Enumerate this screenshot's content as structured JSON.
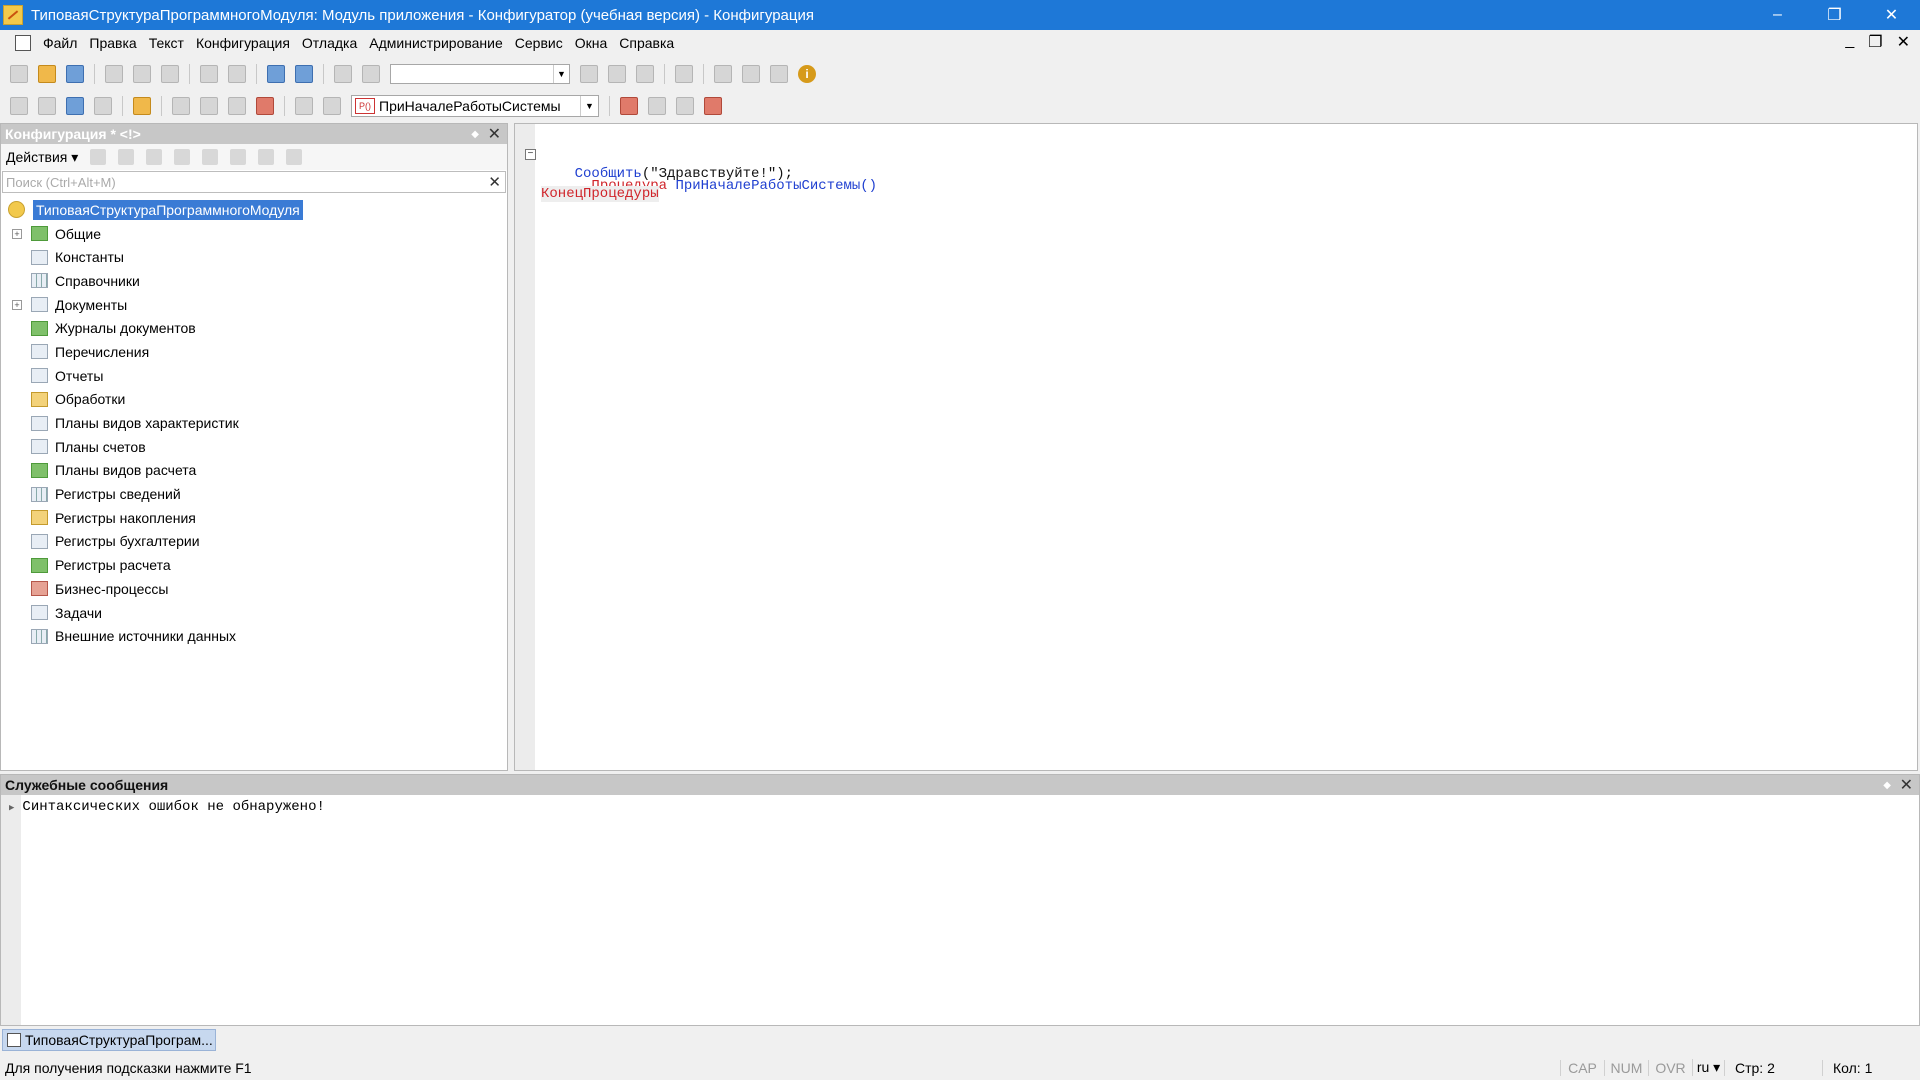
{
  "window": {
    "title": "ТиповаяСтруктураПрограммногоМодуля: Модуль приложения - Конфигуратор (учебная версия) - Конфигурация",
    "minimize": "–",
    "restore": "❐",
    "close": "✕"
  },
  "menu": {
    "items": [
      "Файл",
      "Правка",
      "Текст",
      "Конфигурация",
      "Отладка",
      "Администрирование",
      "Сервис",
      "Окна",
      "Справка"
    ],
    "mdi_minimize": "_",
    "mdi_restore": "❐",
    "mdi_close": "✕"
  },
  "toolbar": {
    "procedure_selector": "ПриНачалеРаботыСистемы",
    "info": "i"
  },
  "config_panel": {
    "title": "Конфигурация * <!>",
    "actions_label": "Действия ▾",
    "search_placeholder": "Поиск (Ctrl+Alt+M)",
    "tree": [
      {
        "label": "ТиповаяСтруктураПрограммногоМодуля",
        "icon": "config-root-icon"
      },
      {
        "label": "Общие",
        "icon": "common-icon",
        "expandable": true
      },
      {
        "label": "Константы",
        "icon": "constants-icon"
      },
      {
        "label": "Справочники",
        "icon": "catalogs-icon"
      },
      {
        "label": "Документы",
        "icon": "documents-icon",
        "expandable": true
      },
      {
        "label": "Журналы документов",
        "icon": "document-journals-icon"
      },
      {
        "label": "Перечисления",
        "icon": "enums-icon"
      },
      {
        "label": "Отчеты",
        "icon": "reports-icon"
      },
      {
        "label": "Обработки",
        "icon": "data-processors-icon"
      },
      {
        "label": "Планы видов характеристик",
        "icon": "chart-of-characteristic-types-icon"
      },
      {
        "label": "Планы счетов",
        "icon": "chart-of-accounts-icon"
      },
      {
        "label": "Планы видов расчета",
        "icon": "chart-of-calculation-types-icon"
      },
      {
        "label": "Регистры сведений",
        "icon": "information-registers-icon"
      },
      {
        "label": "Регистры накопления",
        "icon": "accumulation-registers-icon"
      },
      {
        "label": "Регистры бухгалтерии",
        "icon": "accounting-registers-icon"
      },
      {
        "label": "Регистры расчета",
        "icon": "calculation-registers-icon"
      },
      {
        "label": "Бизнес-процессы",
        "icon": "business-processes-icon"
      },
      {
        "label": "Задачи",
        "icon": "tasks-icon"
      },
      {
        "label": "Внешние источники данных",
        "icon": "external-data-sources-icon"
      }
    ]
  },
  "editor": {
    "line1_keyword": "Процедура",
    "line1_name": "ПриНачалеРаботыСистемы()",
    "line2_indent": "    ",
    "line2_call": "Сообщить",
    "line2_args": "(\"Здравствуйте!\");",
    "line3_keyword": "КонецПроцедуры"
  },
  "messages": {
    "title": "Служебные сообщения",
    "text": "Синтаксических ошибок не обнаружено!"
  },
  "taskbar": {
    "tab_label": "ТиповаяСтруктураПрограм..."
  },
  "status": {
    "hint": "Для получения подсказки нажмите F1",
    "cap": "CAP",
    "num": "NUM",
    "ovr": "OVR",
    "lang": "ru ▾",
    "line": "Стр: 2",
    "col": "Кол: 1"
  }
}
